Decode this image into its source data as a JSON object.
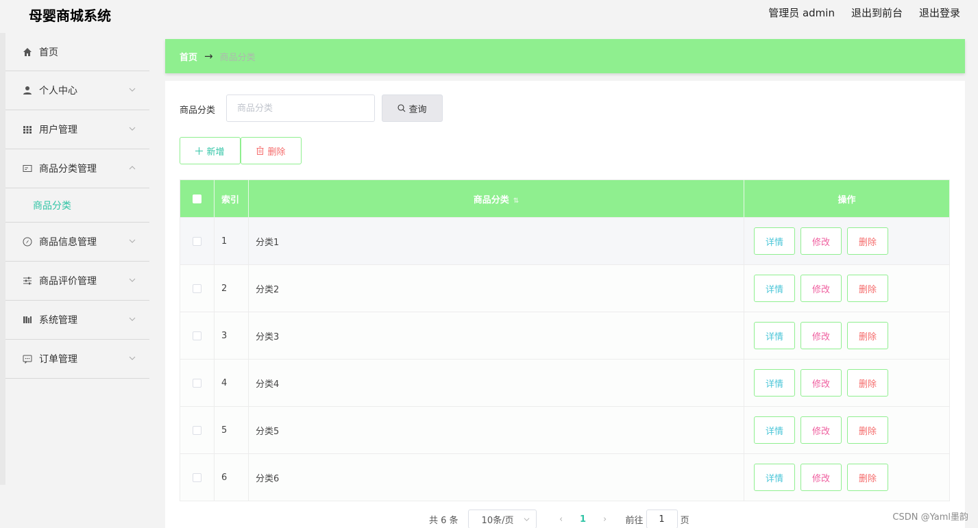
{
  "header": {
    "logo": "母婴商城系统",
    "admin": "管理员 admin",
    "to_front": "退出到前台",
    "logout": "退出登录"
  },
  "sidebar": {
    "items": [
      {
        "label": "首页",
        "icon": "home-icon"
      },
      {
        "label": "个人中心",
        "icon": "user-icon"
      },
      {
        "label": "用户管理",
        "icon": "grid-icon"
      },
      {
        "label": "商品分类管理",
        "icon": "card-icon"
      },
      {
        "label": "商品信息管理",
        "icon": "compass-icon"
      },
      {
        "label": "商品评价管理",
        "icon": "sliders-icon"
      },
      {
        "label": "系统管理",
        "icon": "library-icon"
      },
      {
        "label": "订单管理",
        "icon": "chat-icon"
      }
    ],
    "submenu_label": "商品分类"
  },
  "breadcrumb": {
    "home": "首页",
    "arrow": "→",
    "current": "商品分类"
  },
  "search": {
    "label": "商品分类",
    "placeholder": "商品分类",
    "button": "查询"
  },
  "actions": {
    "add": "新增",
    "delete": "删除"
  },
  "table": {
    "headers": {
      "index": "索引",
      "name": "商品分类",
      "ops": "操作"
    },
    "rows": [
      {
        "index": "1",
        "name": "分类1"
      },
      {
        "index": "2",
        "name": "分类2"
      },
      {
        "index": "3",
        "name": "分类3"
      },
      {
        "index": "4",
        "name": "分类4"
      },
      {
        "index": "5",
        "name": "分类5"
      },
      {
        "index": "6",
        "name": "分类6"
      }
    ],
    "op_labels": {
      "detail": "详情",
      "edit": "修改",
      "delete": "删除"
    }
  },
  "pagination": {
    "total": "共 6 条",
    "page_size": "10条/页",
    "current_page": "1",
    "goto_label": "前往",
    "goto_value": "1",
    "unit": "页"
  },
  "watermark": "CSDN @Yaml墨韵",
  "colors": {
    "accent_green": "#8fef8f",
    "teal": "#31c4a6",
    "danger": "#f56c6c",
    "pink": "#ef5f9f",
    "cyan": "#4cc6d8"
  }
}
